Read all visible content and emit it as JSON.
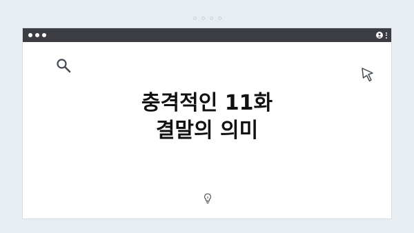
{
  "pager": {
    "dot_count": 4
  },
  "window": {
    "titlebar_color": "#3b3d42",
    "window_controls": 3,
    "icons": {
      "profile": "profile-icon",
      "menu": "kebab-menu-icon",
      "search": "search-icon",
      "cursor": "cursor-arrow-icon",
      "idea": "lightbulb-icon"
    }
  },
  "headline": {
    "line1": "충격적인 11화",
    "line2": "결말의 의미"
  }
}
